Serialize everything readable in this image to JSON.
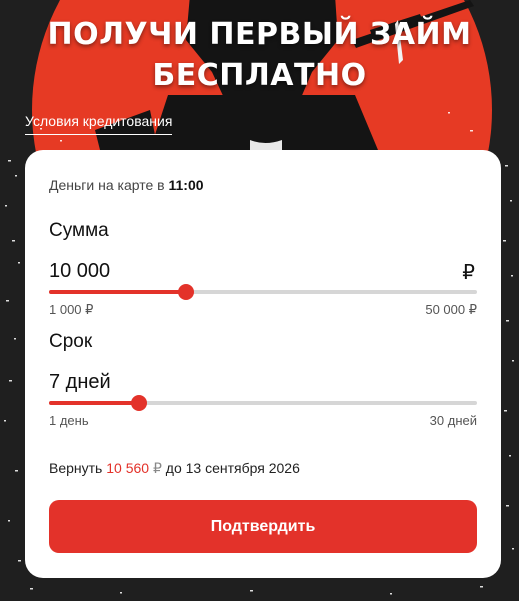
{
  "colors": {
    "accent": "#e3322a",
    "background": "#1f1f1f",
    "card": "#ffffff"
  },
  "header": {
    "line1": "ПОЛУЧИ ПЕРВЫЙ ЗАЙМ",
    "line2": "БЕСПЛАТНО"
  },
  "terms_link": "Условия кредитования",
  "delivery": {
    "prefix": "Деньги на карте в",
    "time": "11:00"
  },
  "amount": {
    "label": "Сумма",
    "value": "10 000",
    "currency": "₽",
    "min": "1 000 ₽",
    "max": "50 000 ₽",
    "fill_fraction": 0.32
  },
  "term": {
    "label": "Срок",
    "value": "7 дней",
    "min": "1 день",
    "max": "30 дней",
    "fill_fraction": 0.21
  },
  "repay": {
    "prefix": "Вернуть",
    "amount": "10 560",
    "currency": "₽",
    "suffix": "до 13 сентября 2026"
  },
  "confirm_button": "Подтвердить"
}
